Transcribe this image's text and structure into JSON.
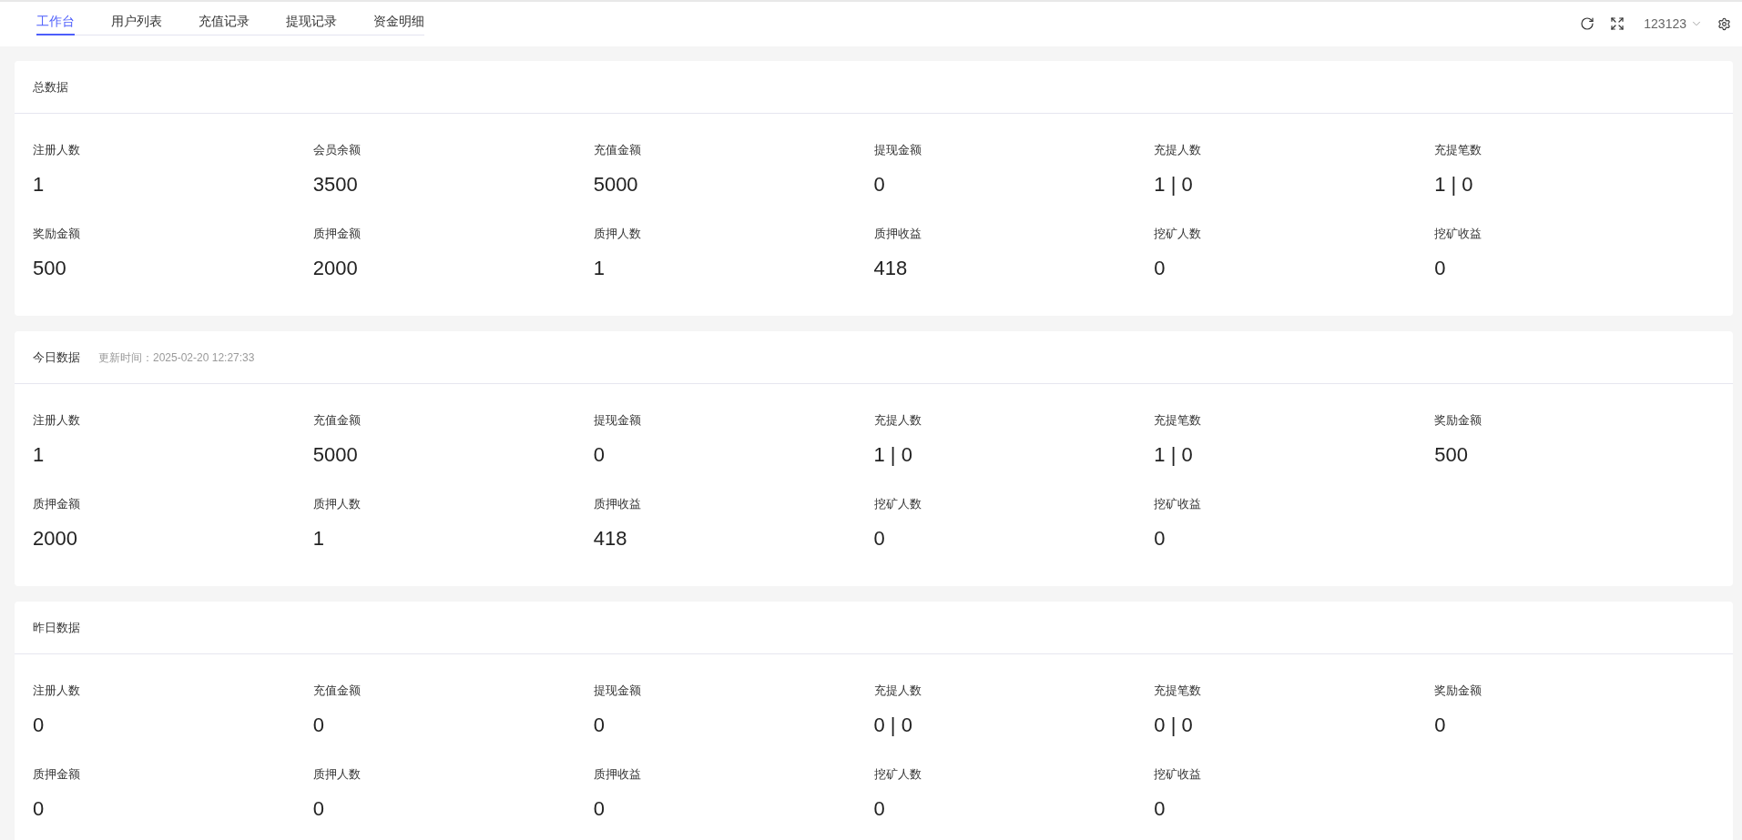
{
  "tabs": [
    {
      "label": "工作台",
      "selected": true
    },
    {
      "label": "用户列表",
      "selected": false
    },
    {
      "label": "充值记录",
      "selected": false
    },
    {
      "label": "提现记录",
      "selected": false
    },
    {
      "label": "资金明细",
      "selected": false
    }
  ],
  "user_menu": {
    "username": "123123"
  },
  "panels": [
    {
      "title": "总数据",
      "stats": [
        {
          "label": "注册人数",
          "value": "1"
        },
        {
          "label": "会员余额",
          "value": "3500"
        },
        {
          "label": "充值金额",
          "value": "5000"
        },
        {
          "label": "提现金额",
          "value": "0"
        },
        {
          "label": "充提人数",
          "value": "1 | 0"
        },
        {
          "label": "充提笔数",
          "value": "1 | 0"
        },
        {
          "label": "奖励金额",
          "value": "500"
        },
        {
          "label": "质押金额",
          "value": "2000"
        },
        {
          "label": "质押人数",
          "value": "1"
        },
        {
          "label": "质押收益",
          "value": "418"
        },
        {
          "label": "挖矿人数",
          "value": "0"
        },
        {
          "label": "挖矿收益",
          "value": "0"
        }
      ]
    },
    {
      "title": "今日数据",
      "update_time": "更新时间：2025-02-20 12:27:33",
      "stats": [
        {
          "label": "注册人数",
          "value": "1"
        },
        {
          "label": "充值金额",
          "value": "5000"
        },
        {
          "label": "提现金额",
          "value": "0"
        },
        {
          "label": "充提人数",
          "value": "1 | 0"
        },
        {
          "label": "充提笔数",
          "value": "1 | 0"
        },
        {
          "label": "奖励金额",
          "value": "500"
        },
        {
          "label": "质押金额",
          "value": "2000"
        },
        {
          "label": "质押人数",
          "value": "1"
        },
        {
          "label": "质押收益",
          "value": "418"
        },
        {
          "label": "挖矿人数",
          "value": "0"
        },
        {
          "label": "挖矿收益",
          "value": "0"
        }
      ]
    },
    {
      "title": "昨日数据",
      "stats": [
        {
          "label": "注册人数",
          "value": "0"
        },
        {
          "label": "充值金额",
          "value": "0"
        },
        {
          "label": "提现金额",
          "value": "0"
        },
        {
          "label": "充提人数",
          "value": "0 | 0"
        },
        {
          "label": "充提笔数",
          "value": "0 | 0"
        },
        {
          "label": "奖励金额",
          "value": "0"
        },
        {
          "label": "质押金额",
          "value": "0"
        },
        {
          "label": "质押人数",
          "value": "0"
        },
        {
          "label": "质押收益",
          "value": "0"
        },
        {
          "label": "挖矿人数",
          "value": "0"
        },
        {
          "label": "挖矿收益",
          "value": "0"
        }
      ]
    }
  ]
}
